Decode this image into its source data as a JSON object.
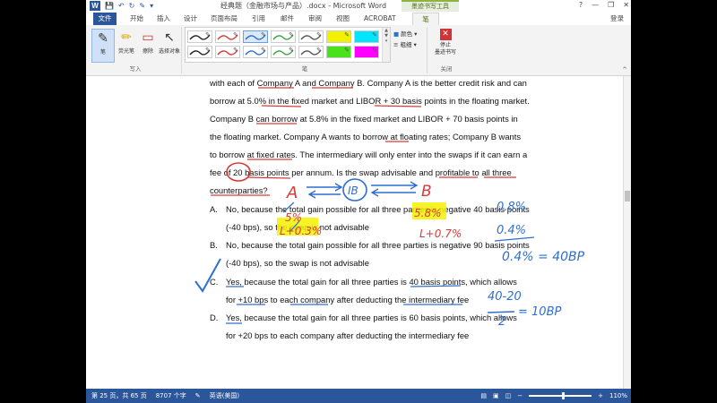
{
  "titlebar": {
    "app_logo": "W",
    "doc_title": "经典题（金融市场与产品）.docx - Microsoft Word",
    "context_tab_header": "墨迹书写工具",
    "window_controls": [
      "?",
      "—",
      "❐",
      "✕"
    ],
    "qat_icons": [
      "save-icon",
      "undo-icon",
      "redo-icon",
      "ink-icon"
    ]
  },
  "tabs": {
    "file": "文件",
    "items": [
      "开始",
      "插入",
      "设计",
      "页面布局",
      "引用",
      "邮件",
      "审阅",
      "视图",
      "ACROBAT",
      "笔"
    ],
    "active": "笔",
    "login": "登录"
  },
  "ribbon": {
    "write_group": {
      "label": "写入",
      "buttons": [
        {
          "label": "笔",
          "icon": "pen-icon"
        },
        {
          "label": "荧光笔",
          "icon": "highlighter-icon"
        },
        {
          "label": "擦除",
          "icon": "eraser-icon"
        },
        {
          "label": "选择对象",
          "icon": "select-arrow-icon"
        }
      ]
    },
    "pens_group": {
      "label": "笔",
      "swatches": [
        {
          "color": "#222222",
          "style": "pen"
        },
        {
          "color": "#d83a3a",
          "style": "pen"
        },
        {
          "color": "#2f6fd1",
          "style": "pen",
          "selected": true
        },
        {
          "color": "#3aa544",
          "style": "pen"
        },
        {
          "color": "#555555",
          "style": "pen"
        },
        {
          "color": "#f2f200",
          "style": "highlighter"
        },
        {
          "color": "#00e5ff",
          "style": "highlighter"
        },
        {
          "color": "#222222",
          "style": "pen"
        },
        {
          "color": "#d83a3a",
          "style": "pen"
        },
        {
          "color": "#2f6fd1",
          "style": "pen"
        },
        {
          "color": "#3aa544",
          "style": "pen"
        },
        {
          "color": "#555555",
          "style": "pen"
        },
        {
          "color": "#49e11a",
          "style": "highlighter"
        },
        {
          "color": "#ff00ff",
          "style": "highlighter"
        }
      ],
      "color_label": "颜色",
      "thickness_label": "粗细"
    },
    "close_group": {
      "label": "关闭",
      "stop_label_1": "停止",
      "stop_label_2": "墨迹书写"
    }
  },
  "document": {
    "lines": [
      "with each of Company A and Company B. Company A is the better credit risk and can",
      "borrow at 5.0% in the fixed market and LIBOR + 30 basis points in the floating market.",
      "Company B can borrow at 5.8% in the fixed market and LIBOR + 70 basis points in",
      "the floating market. Company A wants to borrow at floating rates; Company B wants",
      "to borrow at fixed rates. The intermediary will only enter into the swaps if it can earn a",
      "fee of 20 basis points per annum. Is the swap advisable and profitable to all three",
      "counterparties?"
    ],
    "options": [
      {
        "letter": "A.",
        "line1": "No, because the total gain possible for all three parties is negative 40 basis points",
        "line2": "(-40 bps), so the swap is not advisable"
      },
      {
        "letter": "B.",
        "line1": "No, because the total gain possible for all three parties is negative 90 basis points",
        "line2": "(-40 bps), so the swap is not advisable"
      },
      {
        "letter": "C.",
        "line1": "Yes, because the total gain for all three parties is 40 basis points, which allows",
        "line2": "for +10 bps to each company after deducting the intermediary fee"
      },
      {
        "letter": "D.",
        "line1": "Yes, because the total gain for all three parties is 60 basis points, which allows",
        "line2": "for +20 bps to each company after deducting the intermediary fee"
      }
    ],
    "ink_notes": {
      "node_a": "A",
      "node_ib": "IB",
      "node_b": "B",
      "a_fixed": "5%",
      "b_fixed": "5.8%",
      "a_float": "L+0.3%",
      "b_float": "L+0.7%",
      "diff_1": "0.8%",
      "diff_2": "0.4%",
      "net": "0.4% = 40BP",
      "calc_num": "40-20",
      "calc_den": "2",
      "calc_result": "= 10BP"
    }
  },
  "statusbar": {
    "page": "第 25 页，共 65 页",
    "words": "8707 个字",
    "language": "英语(美国)",
    "zoom": "110%",
    "zoom_level": 0.55
  }
}
